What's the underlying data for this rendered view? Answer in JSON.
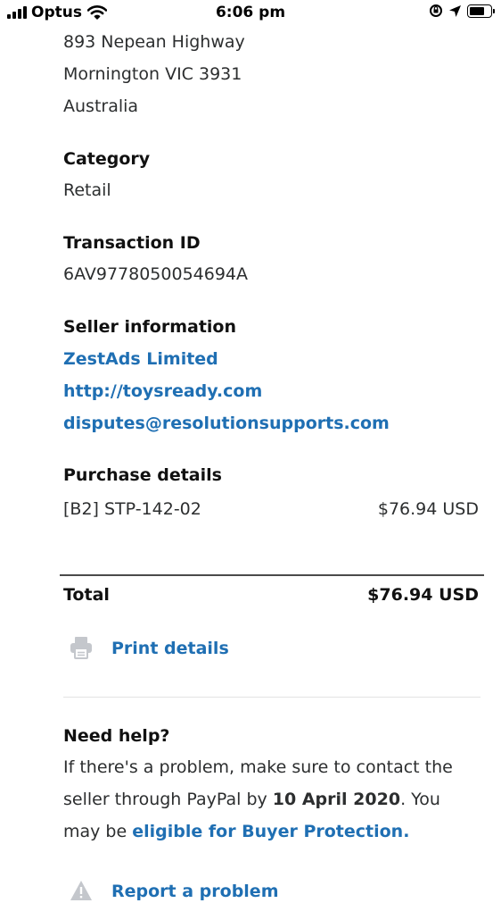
{
  "status_bar": {
    "carrier": "Optus",
    "time": "6:06 pm",
    "battery_level": 0.8
  },
  "address": {
    "line1": "893 Nepean Highway",
    "line2": "Mornington VIC 3931",
    "line3": "Australia"
  },
  "category": {
    "label": "Category",
    "value": "Retail"
  },
  "transaction": {
    "label": "Transaction ID",
    "value": "6AV9778050054694A"
  },
  "seller": {
    "label": "Seller information",
    "name": "ZestAds Limited",
    "website": "http://toysready.com",
    "email": "disputes@resolutionsupports.com"
  },
  "purchase": {
    "label": "Purchase details",
    "item": "[B2] STP-142-02",
    "item_price": "$76.94 USD"
  },
  "total": {
    "label": "Total",
    "value": "$76.94 USD"
  },
  "print": {
    "label": "Print details",
    "icon": "printer-icon"
  },
  "help": {
    "heading": "Need help?",
    "text_before_date": "If there's a problem, make sure to contact the seller through PayPal by ",
    "date": "10 April 2020",
    "text_after_date": ". You may be ",
    "protection_link": "eligible for Buyer Protection."
  },
  "report": {
    "label": "Report a problem",
    "icon": "warning-icon"
  },
  "colors": {
    "link": "#1f6fb3",
    "text": "#2c2e2f",
    "icon_gray": "#c4c7cc"
  }
}
